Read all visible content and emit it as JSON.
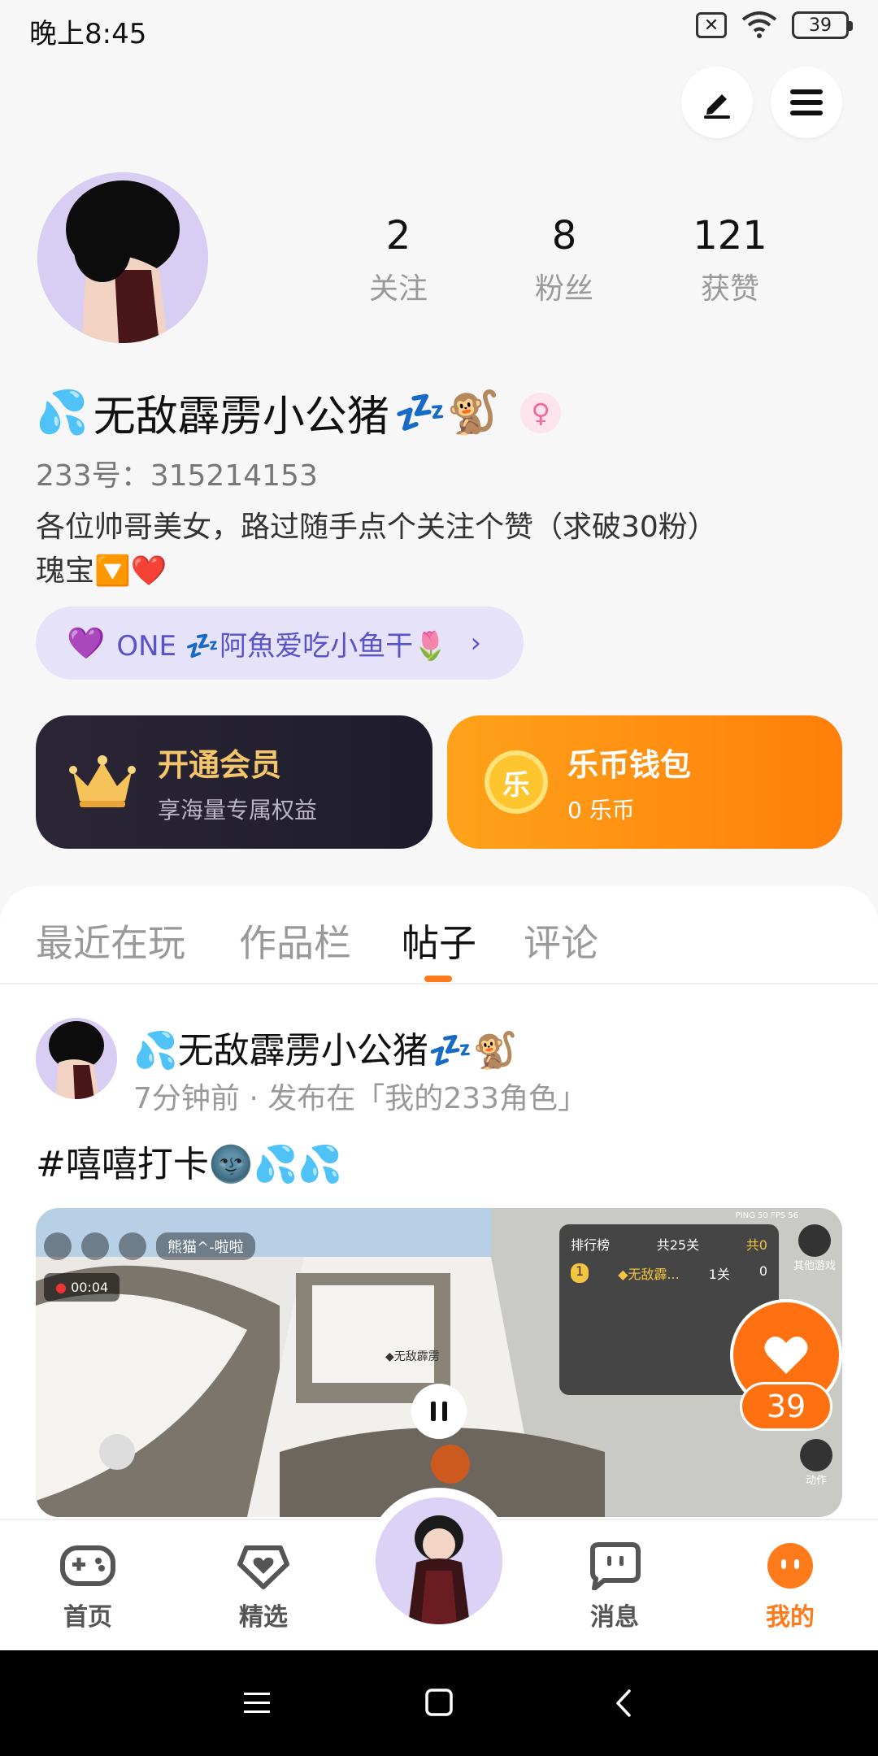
{
  "status_bar": {
    "time": "晚上8:45",
    "battery": "39"
  },
  "profile": {
    "following_count": "2",
    "following_label": "关注",
    "fans_count": "8",
    "fans_label": "粉丝",
    "likes_count": "121",
    "likes_label": "获赞",
    "name_prefix": "💦",
    "name": "无敌霹雳小公猪",
    "name_suffix": "💤🐒",
    "gender_symbol": "♀",
    "uid_label": "233号：315214153",
    "bio_line1": "各位帅哥美女，路过随手点个关注个赞（求破30粉）",
    "bio_line2": "瑰宝🔽❤️",
    "one_tag": "ONE 💤阿魚爱吃小鱼干🌷"
  },
  "cards": {
    "vip_title": "开通会员",
    "vip_sub": "享海量专属权益",
    "wallet_title": "乐币钱包",
    "wallet_sub": "0 乐币",
    "coin_char": "乐"
  },
  "tabs": [
    "最近在玩",
    "作品栏",
    "帖子",
    "评论"
  ],
  "active_tab": "帖子",
  "post": {
    "author": "💦无敌霹雳小公猪💤🐒",
    "meta": "7分钟前 · 发布在「我的233角色」",
    "text": "#嘻嘻打卡🌚💦💦",
    "video": {
      "timer": "00:04",
      "player_tag": "熊猫^-啦啦",
      "leaderboard_title": "排行榜",
      "leaderboard_total": "共25关",
      "leaderboard_total2": "共0",
      "leaderboard_rank": "1",
      "leaderboard_name": "◆无敌霹...",
      "leaderboard_level": "1关",
      "leaderboard_score": "0",
      "other_games": "其他游戏",
      "action_label": "动作",
      "player_name_tag": "◆无敌霹雳",
      "ping": "PING 50  FPS 56"
    },
    "like_count": "39"
  },
  "nav": {
    "home": "首页",
    "featured": "精选",
    "messages": "消息",
    "mine": "我的"
  },
  "colors": {
    "accent": "#ff7a1a",
    "purple": "#5a52c9"
  }
}
